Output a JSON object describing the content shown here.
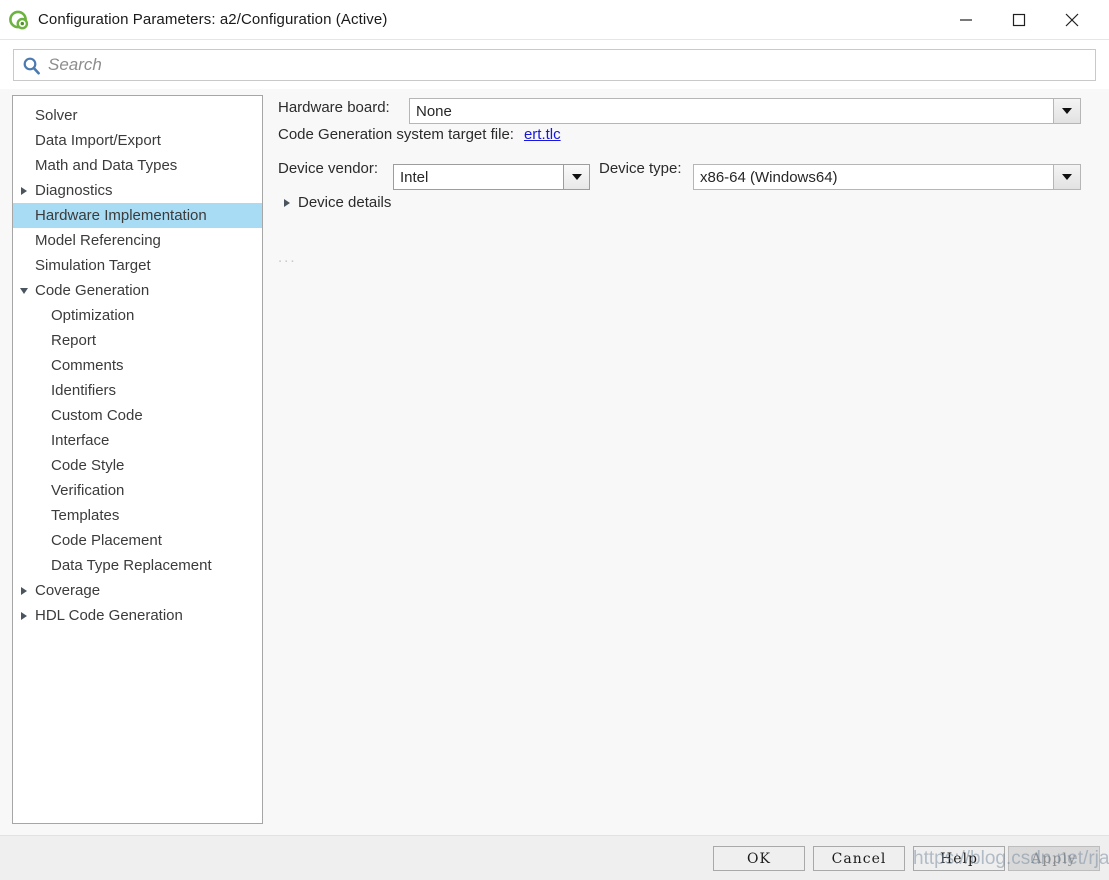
{
  "window": {
    "title": "Configuration Parameters: a2/Configuration (Active)",
    "icon": "simulink-logo-icon",
    "minimize_label": "—",
    "maximize_label": "□",
    "close_label": "✕"
  },
  "search": {
    "placeholder": "Search",
    "value": "",
    "icon": "search-icon"
  },
  "tree": {
    "items": [
      {
        "label": "Solver",
        "level": 0,
        "toggle": "none",
        "selected": false
      },
      {
        "label": "Data Import/Export",
        "level": 0,
        "toggle": "none",
        "selected": false
      },
      {
        "label": "Math and Data Types",
        "level": 0,
        "toggle": "none",
        "selected": false
      },
      {
        "label": "Diagnostics",
        "level": 0,
        "toggle": "closed",
        "selected": false
      },
      {
        "label": "Hardware Implementation",
        "level": 0,
        "toggle": "none",
        "selected": true
      },
      {
        "label": "Model Referencing",
        "level": 0,
        "toggle": "none",
        "selected": false
      },
      {
        "label": "Simulation Target",
        "level": 0,
        "toggle": "none",
        "selected": false
      },
      {
        "label": "Code Generation",
        "level": 0,
        "toggle": "open",
        "selected": false
      },
      {
        "label": "Optimization",
        "level": 1,
        "toggle": "none",
        "selected": false
      },
      {
        "label": "Report",
        "level": 1,
        "toggle": "none",
        "selected": false
      },
      {
        "label": "Comments",
        "level": 1,
        "toggle": "none",
        "selected": false
      },
      {
        "label": "Identifiers",
        "level": 1,
        "toggle": "none",
        "selected": false
      },
      {
        "label": "Custom Code",
        "level": 1,
        "toggle": "none",
        "selected": false
      },
      {
        "label": "Interface",
        "level": 1,
        "toggle": "none",
        "selected": false
      },
      {
        "label": "Code Style",
        "level": 1,
        "toggle": "none",
        "selected": false
      },
      {
        "label": "Verification",
        "level": 1,
        "toggle": "none",
        "selected": false
      },
      {
        "label": "Templates",
        "level": 1,
        "toggle": "none",
        "selected": false
      },
      {
        "label": "Code Placement",
        "level": 1,
        "toggle": "none",
        "selected": false
      },
      {
        "label": "Data Type Replacement",
        "level": 1,
        "toggle": "none",
        "selected": false
      },
      {
        "label": "Coverage",
        "level": 0,
        "toggle": "closed",
        "selected": false
      },
      {
        "label": "HDL Code Generation",
        "level": 0,
        "toggle": "closed",
        "selected": false
      }
    ]
  },
  "detail": {
    "hardware_board": {
      "label": "Hardware board:",
      "value": "None"
    },
    "target_file": {
      "label": "Code Generation system target file:",
      "link_text": "ert.tlc"
    },
    "device_vendor": {
      "label": "Device vendor:",
      "value": "Intel"
    },
    "device_type": {
      "label": "Device type:",
      "value": "x86-64 (Windows64)"
    },
    "device_details": {
      "label": "Device details",
      "toggle": "closed"
    },
    "ellipsis": "..."
  },
  "footer": {
    "ok_label": "OK",
    "cancel_label": "Cancel",
    "help_label": "Help",
    "apply_label": "Apply"
  },
  "watermark": {
    "text": "https://blog.csdn.net/rja_yvel"
  },
  "colors": {
    "selection_blue": "#a8dcf5",
    "link_blue": "#1717e0",
    "footer_bg": "#efefef",
    "panel_bg": "#f8f8f8",
    "tree_text": "#3b3b3b",
    "search_icon_blue": "#4a7ab0"
  }
}
